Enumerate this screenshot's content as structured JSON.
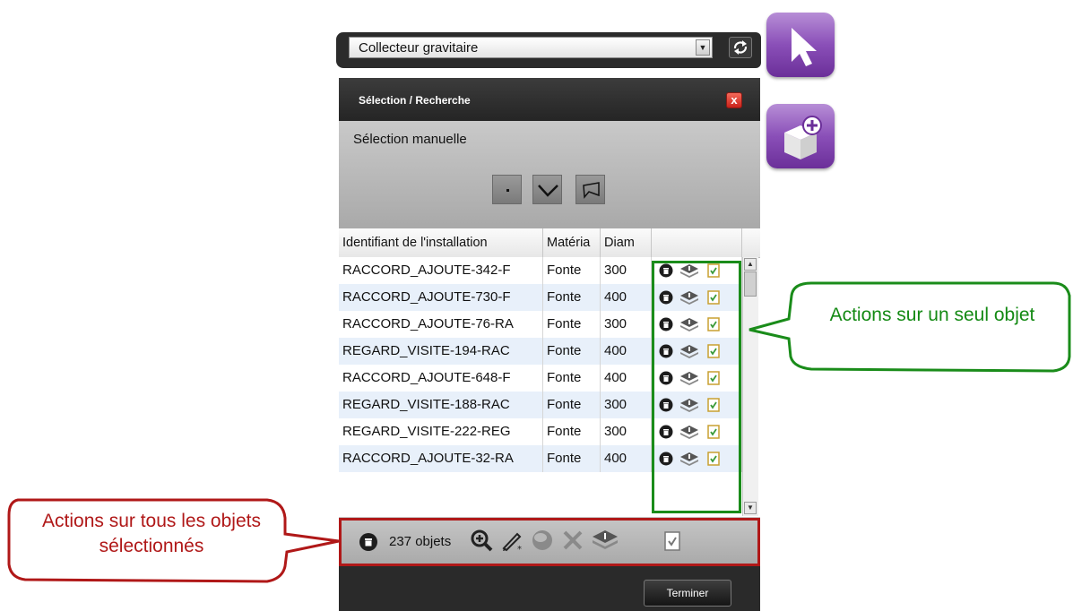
{
  "layer_selector": {
    "value": "Collecteur gravitaire"
  },
  "panel": {
    "title": "Sélection / Recherche",
    "close_label": "x",
    "manual_selection_label": "Sélection manuelle",
    "tools": [
      "point-select-icon",
      "polyline-select-icon",
      "polygon-select-icon"
    ]
  },
  "table": {
    "columns": [
      "Identifiant de l'installation",
      "Matéria",
      "Diam",
      ""
    ],
    "rows": [
      {
        "id": "RACCORD_AJOUTE-342-F",
        "material": "Fonte",
        "diameter": "300"
      },
      {
        "id": "RACCORD_AJOUTE-730-F",
        "material": "Fonte",
        "diameter": "400"
      },
      {
        "id": "RACCORD_AJOUTE-76-RA",
        "material": "Fonte",
        "diameter": "300"
      },
      {
        "id": "REGARD_VISITE-194-RAC",
        "material": "Fonte",
        "diameter": "400"
      },
      {
        "id": "RACCORD_AJOUTE-648-F",
        "material": "Fonte",
        "diameter": "400"
      },
      {
        "id": "REGARD_VISITE-188-RAC",
        "material": "Fonte",
        "diameter": "300"
      },
      {
        "id": "REGARD_VISITE-222-REG",
        "material": "Fonte",
        "diameter": "300"
      },
      {
        "id": "RACCORD_AJOUTE-32-RA",
        "material": "Fonte",
        "diameter": "400"
      }
    ],
    "row_actions": [
      "delete-icon",
      "layers-icon",
      "report-icon"
    ]
  },
  "bulk_actions": {
    "count_label": "237 objets",
    "icons": [
      "delete-icon",
      "zoom-in-icon",
      "edit-icon",
      "globe-icon",
      "clear-icon",
      "layers-icon",
      "report-icon"
    ]
  },
  "finish_button": "Terminer",
  "annotations": {
    "single": "Actions sur un seul objet",
    "all": "Actions sur tous les objets sélectionnés"
  },
  "colors": {
    "panel_dark": "#2a2a2a",
    "row_alt": "#e8f0fa",
    "purple": "#8a4fb8",
    "annotation_green": "#1a8c1a",
    "annotation_red": "#b01818",
    "close_red": "#c9221a"
  }
}
